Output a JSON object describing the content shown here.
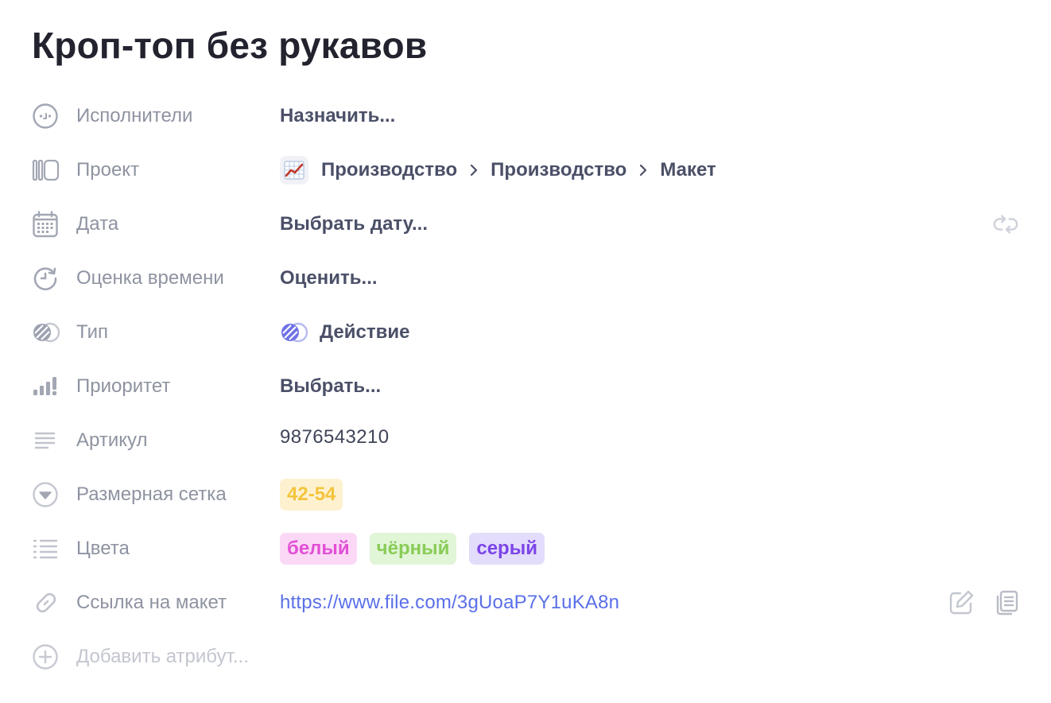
{
  "task": {
    "title": "Кроп-топ без рукавов"
  },
  "attributes": {
    "assignees": {
      "label": "Исполнители",
      "value": "Назначить...",
      "icon": "face-icon"
    },
    "project": {
      "label": "Проект",
      "icon": "project-icon",
      "project_icon": "chart-icon",
      "breadcrumbs": [
        "Производство",
        "Производство",
        "Макет"
      ]
    },
    "date": {
      "label": "Дата",
      "value": "Выбрать дату...",
      "icon": "calendar-icon",
      "action_icon": "repeat-icon"
    },
    "estimate": {
      "label": "Оценка времени",
      "value": "Оценить...",
      "icon": "timer-icon"
    },
    "type": {
      "label": "Тип",
      "value": "Действие",
      "icon": "type-icon",
      "accent": "#6f72e6"
    },
    "priority": {
      "label": "Приоритет",
      "value": "Выбрать...",
      "icon": "priority-bars-icon"
    },
    "sku": {
      "label": "Артикул",
      "value": "9876543210",
      "icon": "text-lines-icon"
    },
    "size_chart": {
      "label": "Размерная сетка",
      "icon": "dropdown-circle-icon",
      "tags": [
        {
          "text": "42-54",
          "bg": "#fdf1cf",
          "fg": "#f4c43c"
        }
      ]
    },
    "colors": {
      "label": "Цвета",
      "icon": "list-icon",
      "tags": [
        {
          "text": "белый",
          "bg": "#fbd9f6",
          "fg": "#e24fd6"
        },
        {
          "text": "чёрный",
          "bg": "#e1f5d7",
          "fg": "#89cc57"
        },
        {
          "text": "серый",
          "bg": "#e3dcfa",
          "fg": "#7c44ea"
        }
      ]
    },
    "mockup_link": {
      "label": "Ссылка на макет",
      "value": "https://www.file.com/3gUoaP7Y1uKA8n",
      "icon": "link-icon",
      "action_icons": [
        "edit-icon",
        "copy-icon"
      ],
      "link_color": "#5a6fe8"
    }
  },
  "add_attribute": {
    "label": "Добавить атрибут...",
    "icon": "plus-circle-icon"
  }
}
